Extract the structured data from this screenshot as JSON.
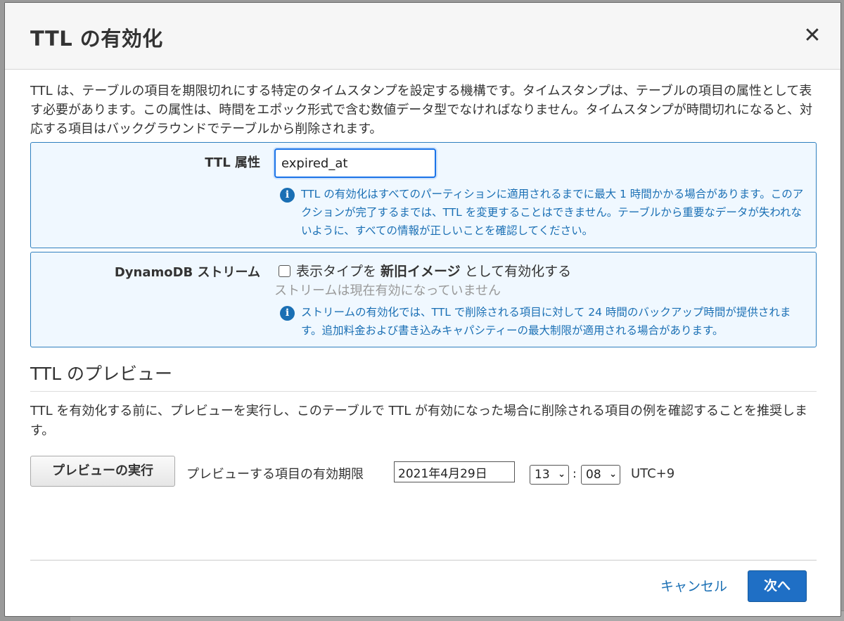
{
  "modal": {
    "title": "TTL の有効化",
    "close_symbol": "✕",
    "intro": "TTL は、テーブルの項目を期限切れにする特定のタイムスタンプを設定する機構です。タイムスタンプは、テーブルの項目の属性として表す必要があります。この属性は、時間をエポック形式で含む数値データ型でなければなりません。タイムスタンプが時間切れになると、対応する項目はバックグラウンドでテーブルから削除されます。"
  },
  "ttl_panel": {
    "label": "TTL 属性",
    "input_value": "expired_at",
    "info": "TTL の有効化はすべてのパーティションに適用されるまでに最大 1 時間かかる場合があります。このアクションが完了するまでは、TTL を変更することはできません。テーブルから重要なデータが失われないように、すべての情報が正しいことを確認してください。"
  },
  "stream_panel": {
    "label": "DynamoDB ストリーム",
    "checkbox_prefix": "表示タイプを ",
    "checkbox_bold": "新旧イメージ",
    "checkbox_suffix": " として有効化する",
    "status": "ストリームは現在有効になっていません",
    "info": "ストリームの有効化では、TTL で削除される項目に対して 24 時間のバックアップ時間が提供されます。追加料金および書き込みキャパシティーの最大制限が適用される場合があります。"
  },
  "preview": {
    "title": "TTL のプレビュー",
    "description": "TTL を有効化する前に、プレビューを実行し、このテーブルで TTL が有効になった場合に削除される項目の例を確認することを推奨します。",
    "run_button": "プレビューの実行",
    "expiry_label": "プレビューする項目の有効期限",
    "date_value": "2021年4月29日",
    "hour": "13",
    "minute": "08",
    "timezone": "UTC+9"
  },
  "footer": {
    "cancel": "キャンセル",
    "next": "次へ"
  },
  "colors": {
    "accent": "#1f6fc5",
    "info_text": "#1a6fb4",
    "panel_bg": "#f0f8ff",
    "panel_border": "#2e7fbf"
  },
  "icons": {
    "info": "info-icon",
    "close": "close-icon",
    "chevron": "chevron-down-icon"
  }
}
